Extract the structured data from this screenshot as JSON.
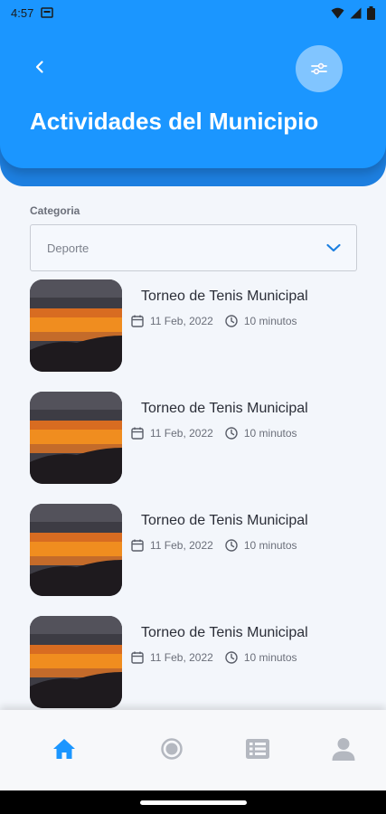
{
  "status_bar": {
    "time": "4:57"
  },
  "header": {
    "title": "Actividades del Municipio",
    "back_icon": "chevron-left-icon",
    "filter_icon": "sliders-icon",
    "color": "#1b96ff"
  },
  "filter": {
    "label": "Categoria",
    "selected": "Deporte"
  },
  "activities": [
    {
      "title": "Torneo de Tenis Municipal",
      "date": "11 Feb, 2022",
      "duration": "10 minutos"
    },
    {
      "title": "Torneo de Tenis Municipal",
      "date": "11 Feb, 2022",
      "duration": "10 minutos"
    },
    {
      "title": "Torneo de Tenis Municipal",
      "date": "11 Feb, 2022",
      "duration": "10 minutos"
    },
    {
      "title": "Torneo de Tenis Municipal",
      "date": "11 Feb, 2022",
      "duration": "10 minutos"
    }
  ],
  "bottom_nav": {
    "items": [
      "home-icon",
      "location-icon",
      "list-icon",
      "profile-icon"
    ],
    "active": "home-icon",
    "active_color": "#1b96ff",
    "inactive_color": "#b4b8c0"
  }
}
